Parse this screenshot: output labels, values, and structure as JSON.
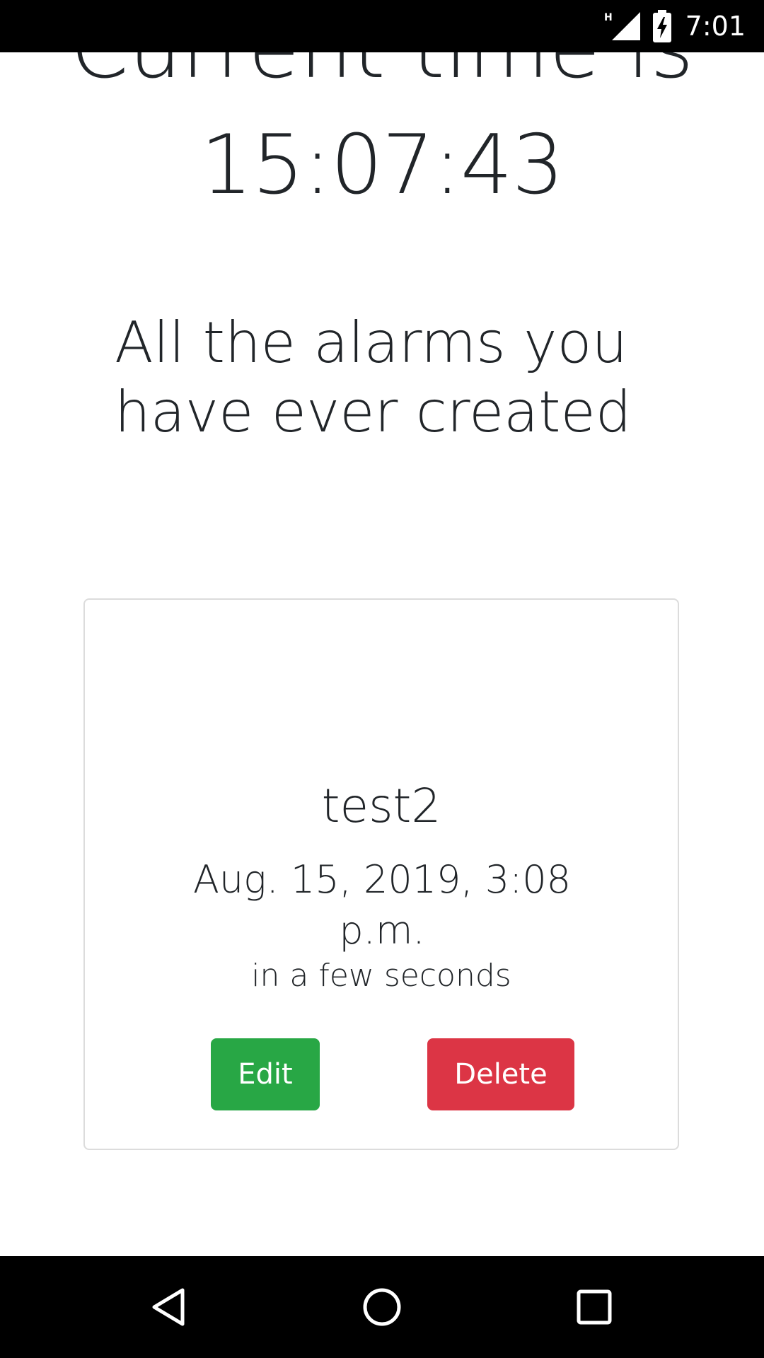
{
  "status_bar": {
    "time": "7:01",
    "network_label": "H",
    "icons": [
      "network-type-icon",
      "signal-icon",
      "battery-charging-icon"
    ]
  },
  "page": {
    "heading": "Current time is",
    "clock": "15:07:43",
    "section_title": "All the alarms you have ever created"
  },
  "alarms": [
    {
      "name": "test2",
      "datetime": "Aug. 15, 2019, 3:08 p.m.",
      "relative": "in a few seconds",
      "edit_label": "Edit",
      "delete_label": "Delete"
    }
  ],
  "colors": {
    "edit_button": "#28a745",
    "delete_button": "#dc3545",
    "text": "#212529",
    "card_border": "#dcdcdc"
  },
  "nav_bar": {
    "buttons": [
      "back-icon",
      "home-icon",
      "recents-icon"
    ]
  }
}
